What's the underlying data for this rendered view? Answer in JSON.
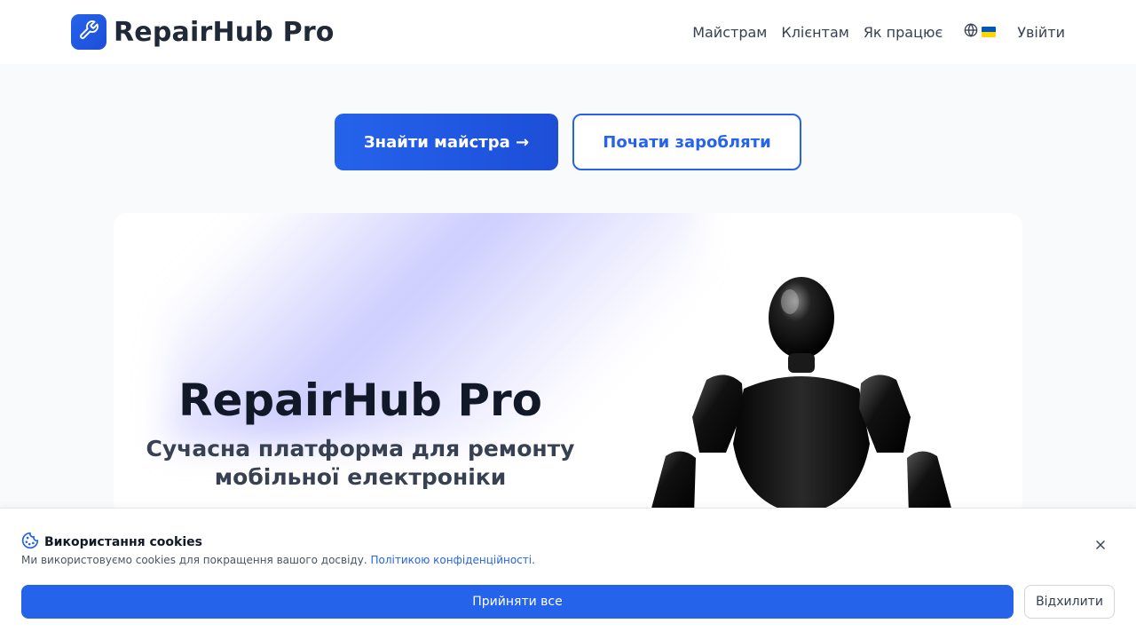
{
  "header": {
    "brand": "RepairHub Pro",
    "logo_icon": "wrench-icon",
    "nav": [
      {
        "label": "Майстрам"
      },
      {
        "label": "Клієнтам"
      },
      {
        "label": "Як працює"
      }
    ],
    "language_icon": "globe-icon",
    "language_flag": "ukraine-flag-icon",
    "login_label": "Увійти"
  },
  "hero": {
    "find_button": "Знайти майстра →",
    "earn_button": "Почати заробляти",
    "title": "RepairHub Pro",
    "subtitle": "Сучасна платформа для ремонту мобільної електроніки",
    "image_icon": "robot-illustration"
  },
  "cookie": {
    "icon": "cookie-icon",
    "title": "Використання cookies",
    "text": "Ми використовуємо cookies для покращення вашого досвіду.",
    "link": "Політикою конфіденційності.",
    "close_icon": "close-icon",
    "accept_label": "Прийняти все",
    "reject_label": "Відхилити"
  },
  "colors": {
    "accent": "#2563eb",
    "text_dark": "#111827",
    "text_muted": "#374151"
  }
}
